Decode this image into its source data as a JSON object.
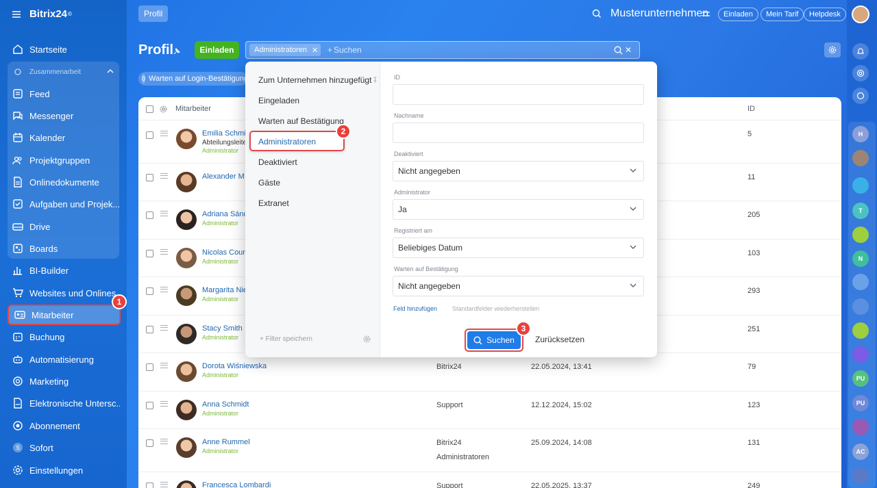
{
  "sidebar": {
    "logo": "Bitrix24",
    "logo_mark": "©",
    "group_label": "Zusammenarbeit",
    "items": [
      {
        "label": "Startseite",
        "icon": "home-icon"
      },
      {
        "label": "Feed",
        "icon": "feed-icon"
      },
      {
        "label": "Messenger",
        "icon": "chat-icon"
      },
      {
        "label": "Kalender",
        "icon": "calendar-icon"
      },
      {
        "label": "Projektgruppen",
        "icon": "group-icon"
      },
      {
        "label": "Onlinedokumente",
        "icon": "document-icon"
      },
      {
        "label": "Aufgaben und Projek...",
        "icon": "task-icon"
      },
      {
        "label": "Drive",
        "icon": "drive-icon"
      },
      {
        "label": "Boards",
        "icon": "board-icon"
      },
      {
        "label": "BI-Builder",
        "icon": "chart-icon"
      },
      {
        "label": "Websites und Onlines...",
        "icon": "cart-icon"
      },
      {
        "label": "Mitarbeiter",
        "icon": "id-card-icon"
      },
      {
        "label": "Buchung",
        "icon": "booking-icon"
      },
      {
        "label": "Automatisierung",
        "icon": "robot-icon"
      },
      {
        "label": "Marketing",
        "icon": "target-icon"
      },
      {
        "label": "Elektronische Untersc...",
        "icon": "signature-icon"
      },
      {
        "label": "Abonnement",
        "icon": "subscription-icon"
      },
      {
        "label": "Sofort",
        "icon": "s-icon"
      },
      {
        "label": "Einstellungen",
        "icon": "gear-icon"
      }
    ]
  },
  "topbar": {
    "tab": "Profil",
    "company": "Musterunternehmen",
    "invite": "Einladen",
    "tariff": "Mein Tarif",
    "helpdesk": "Helpdesk"
  },
  "header": {
    "title": "Profil",
    "invite_button": "Einladen",
    "filter_tag": "Administratoren",
    "search_placeholder": "Suchen",
    "search_prefix": "+",
    "counter_badge": "0",
    "counter_text": "Warten auf Login-Bestätigung"
  },
  "table": {
    "col_employee": "Mitarbeiter",
    "col_id": "ID",
    "rows": [
      {
        "name": "Emilia Schmi",
        "sub": "Abteilungsleite",
        "role": "Administrator",
        "dept": "",
        "date": "",
        "id": "5"
      },
      {
        "name": "Alexander M",
        "sub": "",
        "role": "",
        "dept": "",
        "date": "",
        "id": "11"
      },
      {
        "name": "Adriana Sánc",
        "sub": "",
        "role": "Administrator",
        "dept": "",
        "date": "",
        "id": "205"
      },
      {
        "name": "Nicolas Cour",
        "sub": "",
        "role": "Administrator",
        "dept": "",
        "date": "",
        "id": "103"
      },
      {
        "name": "Margarita Nie",
        "sub": "",
        "role": "Administrator",
        "dept": "",
        "date": "",
        "id": "293"
      },
      {
        "name": "Stacy Smith",
        "sub": "",
        "role": "Administrator",
        "dept": "",
        "date": "",
        "id": "251"
      },
      {
        "name": "Dorota Wiśniewska",
        "sub": "",
        "role": "Administrator",
        "dept": "Bitrix24",
        "date": "22.05.2024, 13:41",
        "id": "79"
      },
      {
        "name": "Anna Schmidt",
        "sub": "",
        "role": "Administrator",
        "dept": "Support",
        "date": "12.12.2024, 15:02",
        "id": "123"
      },
      {
        "name": "Anne Rummel",
        "sub": "",
        "role": "Administrator",
        "dept": "Bitrix24",
        "dept2": "Administratoren",
        "date": "25.09.2024, 14:08",
        "id": "131"
      },
      {
        "name": "Francesca Lombardi",
        "sub": "",
        "role": "",
        "dept": "Support",
        "date": "22.05.2025, 13:37",
        "id": "249"
      }
    ]
  },
  "filter": {
    "presets": [
      "Zum Unternehmen hinzugefügt",
      "Eingeladen",
      "Warten auf Bestätigung",
      "Administratoren",
      "Deaktiviert",
      "Gäste",
      "Extranet"
    ],
    "save_filter": "+ Filter speichern",
    "fields": {
      "id_label": "ID",
      "lastname_label": "Nachname",
      "deactivated_label": "Deaktiviert",
      "deactivated_value": "Nicht angegeben",
      "admin_label": "Administrator",
      "admin_value": "Ja",
      "registered_label": "Registriert am",
      "registered_value": "Beliebiges Datum",
      "waiting_label": "Warten auf Bestätigung",
      "waiting_value": "Nicht angegeben"
    },
    "add_field": "Feld hinzufügen",
    "restore_fields": "Standardfelder wiederherstellen",
    "search_button": "Suchen",
    "reset_button": "Zurücksetzen"
  },
  "steps": [
    "1",
    "2",
    "3"
  ],
  "rightbar": {
    "labels": [
      "H",
      "T",
      "N",
      "PU",
      "PU",
      "AC"
    ]
  },
  "colors": {
    "accent_green": "#43b41f",
    "link_blue": "#2067b0",
    "primary_button": "#1f7ce8",
    "highlight_red": "#e0474c",
    "admin_green": "#7bb73a"
  }
}
